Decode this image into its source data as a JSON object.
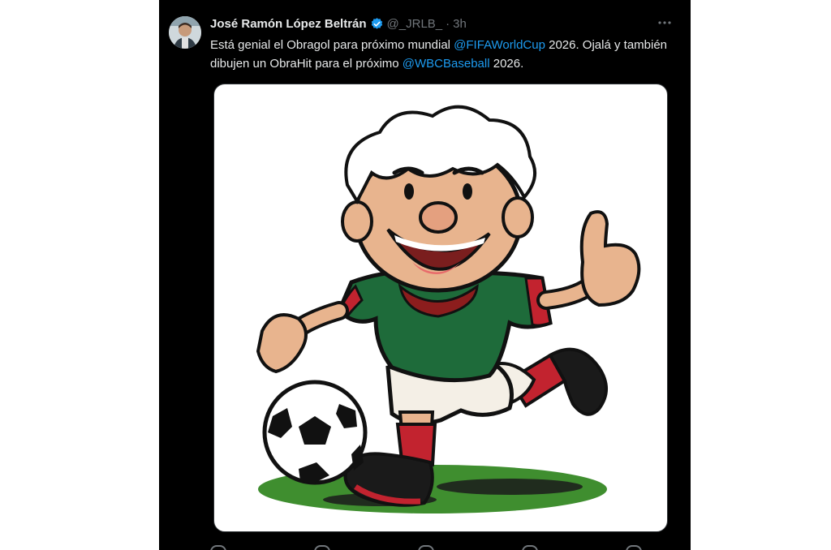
{
  "tweet": {
    "author_name": "José Ramón López Beltrán",
    "handle": "@_JRLB_",
    "separator": "·",
    "time": "3h",
    "more_icon": "more-horizontal-icon",
    "verified_icon": "verified-badge-icon",
    "text_parts": {
      "p1": "Está genial el Obragol para próximo mundial ",
      "mention1": "@FIFAWorldCup",
      "p2": " 2026. Ojalá y también dibujen un ObraHit para el próximo ",
      "mention2": "@WBCBaseball",
      "p3": " 2026."
    },
    "media_description": "cartoon-soccer-player-image"
  },
  "colors": {
    "background": "#000000",
    "text": "#e7e9ea",
    "muted": "#71767b",
    "link": "#1d9bf0",
    "jersey": "#1e6b3a",
    "socks": "#c2232f"
  }
}
